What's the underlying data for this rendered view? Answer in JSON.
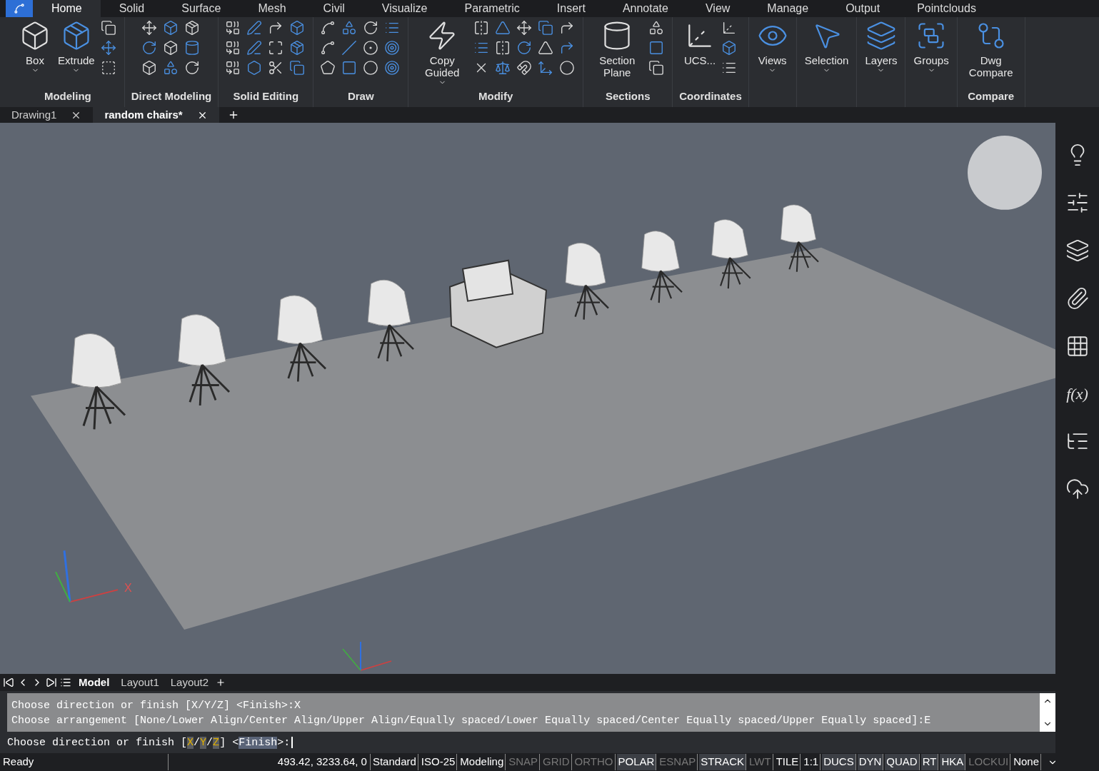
{
  "ribbon_tabs": [
    {
      "label": "Home",
      "selected": true
    },
    {
      "label": "Solid",
      "selected": false
    },
    {
      "label": "Surface",
      "selected": false
    },
    {
      "label": "Mesh",
      "selected": false
    },
    {
      "label": "Civil",
      "selected": false
    },
    {
      "label": "Visualize",
      "selected": false
    },
    {
      "label": "Parametric",
      "selected": false
    },
    {
      "label": "Insert",
      "selected": false
    },
    {
      "label": "Annotate",
      "selected": false
    },
    {
      "label": "View",
      "selected": false
    },
    {
      "label": "Manage",
      "selected": false
    },
    {
      "label": "Output",
      "selected": false
    },
    {
      "label": "Pointclouds",
      "selected": false
    }
  ],
  "ribbon_panels": [
    {
      "title": "Modeling",
      "buttons": [
        {
          "label": "Box",
          "dropdown": true
        },
        {
          "label": "Extrude",
          "dropdown": true
        }
      ]
    },
    {
      "title": "Direct Modeling"
    },
    {
      "title": "Solid Editing"
    },
    {
      "title": "Draw"
    },
    {
      "title": "Modify",
      "buttons": [
        {
          "label": "Copy Guided",
          "dropdown": true
        }
      ]
    },
    {
      "title": "Sections",
      "buttons": [
        {
          "label": "Section Plane",
          "dropdown": false
        }
      ]
    },
    {
      "title": "Coordinates",
      "buttons": [
        {
          "label": "UCS...",
          "dropdown": false
        }
      ]
    },
    {
      "buttons": [
        {
          "label": "Views",
          "dropdown": true
        }
      ]
    },
    {
      "buttons": [
        {
          "label": "Selection",
          "dropdown": true
        }
      ]
    },
    {
      "buttons": [
        {
          "label": "Layers",
          "dropdown": true
        }
      ]
    },
    {
      "buttons": [
        {
          "label": "Groups",
          "dropdown": true
        }
      ]
    },
    {
      "title": "Compare",
      "buttons": [
        {
          "label": "Dwg Compare",
          "dropdown": false
        }
      ]
    }
  ],
  "document_tabs": [
    {
      "label": "Drawing1",
      "selected": false
    },
    {
      "label": "random chairs*",
      "selected": true
    }
  ],
  "viewport": {
    "axis_label": "X"
  },
  "side_panel": {
    "function_label": "f(x)"
  },
  "layout_tabs": [
    {
      "label": "Model",
      "selected": true
    },
    {
      "label": "Layout1",
      "selected": false
    },
    {
      "label": "Layout2",
      "selected": false
    }
  ],
  "command_history": [
    "Choose direction or finish [X/Y/Z] <Finish>:X",
    "Choose arrangement [None/Lower Align/Center Align/Upper Align/Equally spaced/Lower Equally spaced/Center Equally spaced/Upper Equally spaced]:E"
  ],
  "command_prompt": [
    {
      "text": "Choose direction or finish [",
      "kind": "plain"
    },
    {
      "text": "X",
      "kind": "option"
    },
    {
      "text": "/",
      "kind": "plain"
    },
    {
      "text": "Y",
      "kind": "option"
    },
    {
      "text": "/",
      "kind": "plain"
    },
    {
      "text": "Z",
      "kind": "option"
    },
    {
      "text": "] <",
      "kind": "plain"
    },
    {
      "text": "Finish",
      "kind": "default"
    },
    {
      "text": ">:",
      "kind": "plain"
    }
  ],
  "status_bar": {
    "state": "Ready",
    "coordinates": "493.42, 3233.64, 0",
    "items": [
      {
        "kind": "field",
        "label": "Standard"
      },
      {
        "kind": "field",
        "label": "ISO-25"
      },
      {
        "kind": "field",
        "label": "Modeling"
      },
      {
        "kind": "toggle",
        "label": "SNAP",
        "on": false
      },
      {
        "kind": "toggle",
        "label": "GRID",
        "on": false
      },
      {
        "kind": "toggle",
        "label": "ORTHO",
        "on": false
      },
      {
        "kind": "toggle",
        "label": "POLAR",
        "on": true
      },
      {
        "kind": "toggle",
        "label": "ESNAP",
        "on": false
      },
      {
        "kind": "toggle",
        "label": "STRACK",
        "on": true
      },
      {
        "kind": "toggle",
        "label": "LWT",
        "on": false
      },
      {
        "kind": "field",
        "label": "TILE"
      },
      {
        "kind": "field",
        "label": "1:1"
      },
      {
        "kind": "toggle",
        "label": "DUCS",
        "on": true
      },
      {
        "kind": "toggle",
        "label": "DYN",
        "on": true
      },
      {
        "kind": "toggle",
        "label": "QUAD",
        "on": true
      },
      {
        "kind": "toggle",
        "label": "RT",
        "on": true
      },
      {
        "kind": "toggle",
        "label": "HKA",
        "on": true
      },
      {
        "kind": "toggle",
        "label": "LOCKUI",
        "on": false
      },
      {
        "kind": "field",
        "label": "None"
      }
    ]
  }
}
